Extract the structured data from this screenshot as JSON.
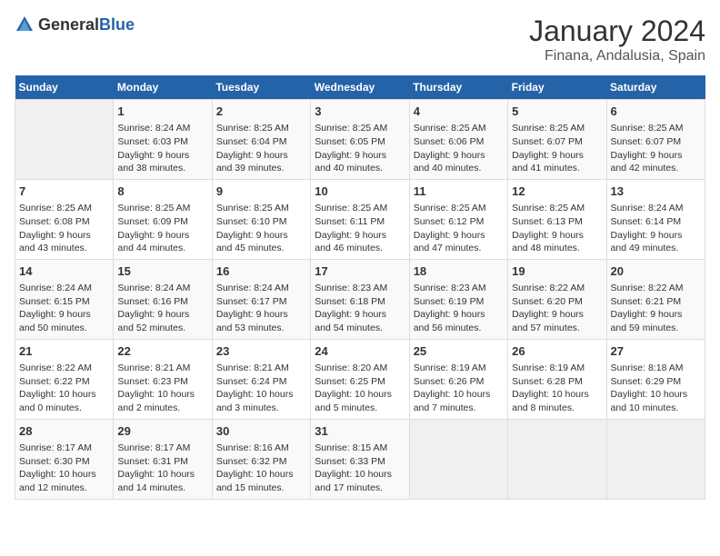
{
  "logo": {
    "text_general": "General",
    "text_blue": "Blue"
  },
  "title": "January 2024",
  "subtitle": "Finana, Andalusia, Spain",
  "headers": [
    "Sunday",
    "Monday",
    "Tuesday",
    "Wednesday",
    "Thursday",
    "Friday",
    "Saturday"
  ],
  "weeks": [
    [
      {
        "day": "",
        "info": ""
      },
      {
        "day": "1",
        "info": "Sunrise: 8:24 AM\nSunset: 6:03 PM\nDaylight: 9 hours\nand 38 minutes."
      },
      {
        "day": "2",
        "info": "Sunrise: 8:25 AM\nSunset: 6:04 PM\nDaylight: 9 hours\nand 39 minutes."
      },
      {
        "day": "3",
        "info": "Sunrise: 8:25 AM\nSunset: 6:05 PM\nDaylight: 9 hours\nand 40 minutes."
      },
      {
        "day": "4",
        "info": "Sunrise: 8:25 AM\nSunset: 6:06 PM\nDaylight: 9 hours\nand 40 minutes."
      },
      {
        "day": "5",
        "info": "Sunrise: 8:25 AM\nSunset: 6:07 PM\nDaylight: 9 hours\nand 41 minutes."
      },
      {
        "day": "6",
        "info": "Sunrise: 8:25 AM\nSunset: 6:07 PM\nDaylight: 9 hours\nand 42 minutes."
      }
    ],
    [
      {
        "day": "7",
        "info": "Sunrise: 8:25 AM\nSunset: 6:08 PM\nDaylight: 9 hours\nand 43 minutes."
      },
      {
        "day": "8",
        "info": "Sunrise: 8:25 AM\nSunset: 6:09 PM\nDaylight: 9 hours\nand 44 minutes."
      },
      {
        "day": "9",
        "info": "Sunrise: 8:25 AM\nSunset: 6:10 PM\nDaylight: 9 hours\nand 45 minutes."
      },
      {
        "day": "10",
        "info": "Sunrise: 8:25 AM\nSunset: 6:11 PM\nDaylight: 9 hours\nand 46 minutes."
      },
      {
        "day": "11",
        "info": "Sunrise: 8:25 AM\nSunset: 6:12 PM\nDaylight: 9 hours\nand 47 minutes."
      },
      {
        "day": "12",
        "info": "Sunrise: 8:25 AM\nSunset: 6:13 PM\nDaylight: 9 hours\nand 48 minutes."
      },
      {
        "day": "13",
        "info": "Sunrise: 8:24 AM\nSunset: 6:14 PM\nDaylight: 9 hours\nand 49 minutes."
      }
    ],
    [
      {
        "day": "14",
        "info": "Sunrise: 8:24 AM\nSunset: 6:15 PM\nDaylight: 9 hours\nand 50 minutes."
      },
      {
        "day": "15",
        "info": "Sunrise: 8:24 AM\nSunset: 6:16 PM\nDaylight: 9 hours\nand 52 minutes."
      },
      {
        "day": "16",
        "info": "Sunrise: 8:24 AM\nSunset: 6:17 PM\nDaylight: 9 hours\nand 53 minutes."
      },
      {
        "day": "17",
        "info": "Sunrise: 8:23 AM\nSunset: 6:18 PM\nDaylight: 9 hours\nand 54 minutes."
      },
      {
        "day": "18",
        "info": "Sunrise: 8:23 AM\nSunset: 6:19 PM\nDaylight: 9 hours\nand 56 minutes."
      },
      {
        "day": "19",
        "info": "Sunrise: 8:22 AM\nSunset: 6:20 PM\nDaylight: 9 hours\nand 57 minutes."
      },
      {
        "day": "20",
        "info": "Sunrise: 8:22 AM\nSunset: 6:21 PM\nDaylight: 9 hours\nand 59 minutes."
      }
    ],
    [
      {
        "day": "21",
        "info": "Sunrise: 8:22 AM\nSunset: 6:22 PM\nDaylight: 10 hours\nand 0 minutes."
      },
      {
        "day": "22",
        "info": "Sunrise: 8:21 AM\nSunset: 6:23 PM\nDaylight: 10 hours\nand 2 minutes."
      },
      {
        "day": "23",
        "info": "Sunrise: 8:21 AM\nSunset: 6:24 PM\nDaylight: 10 hours\nand 3 minutes."
      },
      {
        "day": "24",
        "info": "Sunrise: 8:20 AM\nSunset: 6:25 PM\nDaylight: 10 hours\nand 5 minutes."
      },
      {
        "day": "25",
        "info": "Sunrise: 8:19 AM\nSunset: 6:26 PM\nDaylight: 10 hours\nand 7 minutes."
      },
      {
        "day": "26",
        "info": "Sunrise: 8:19 AM\nSunset: 6:28 PM\nDaylight: 10 hours\nand 8 minutes."
      },
      {
        "day": "27",
        "info": "Sunrise: 8:18 AM\nSunset: 6:29 PM\nDaylight: 10 hours\nand 10 minutes."
      }
    ],
    [
      {
        "day": "28",
        "info": "Sunrise: 8:17 AM\nSunset: 6:30 PM\nDaylight: 10 hours\nand 12 minutes."
      },
      {
        "day": "29",
        "info": "Sunrise: 8:17 AM\nSunset: 6:31 PM\nDaylight: 10 hours\nand 14 minutes."
      },
      {
        "day": "30",
        "info": "Sunrise: 8:16 AM\nSunset: 6:32 PM\nDaylight: 10 hours\nand 15 minutes."
      },
      {
        "day": "31",
        "info": "Sunrise: 8:15 AM\nSunset: 6:33 PM\nDaylight: 10 hours\nand 17 minutes."
      },
      {
        "day": "",
        "info": ""
      },
      {
        "day": "",
        "info": ""
      },
      {
        "day": "",
        "info": ""
      }
    ]
  ]
}
